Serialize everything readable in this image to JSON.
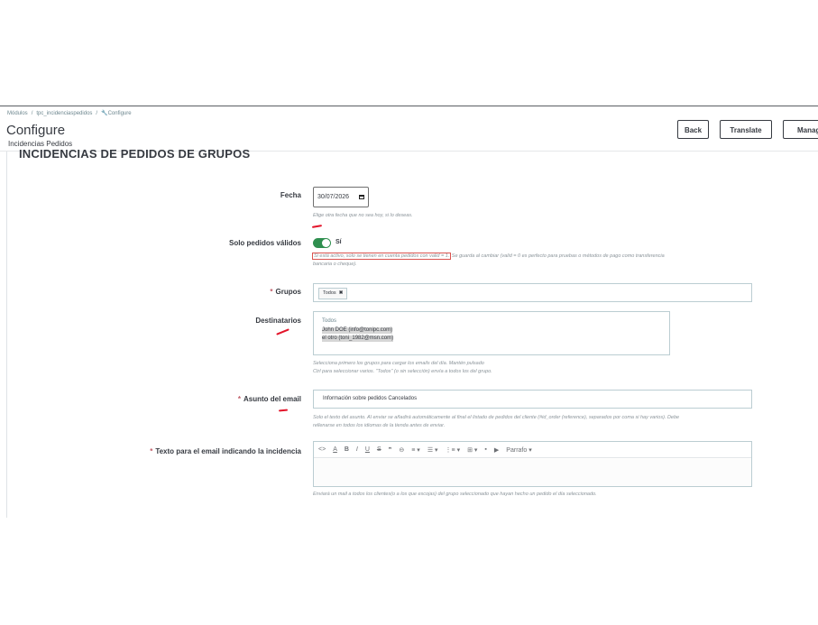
{
  "breadcrumb": [
    "Módulos",
    "tpc_incidenciaspedidos",
    "Configure"
  ],
  "header": {
    "title": "Configure",
    "subtitle": "Incidencias Pedidos",
    "buttons": {
      "back": "Back",
      "translate": "Translate",
      "manage": "Manage hoo"
    }
  },
  "section_title": "INCIDENCIAS DE PEDIDOS DE GRUPOS",
  "fields": {
    "fecha": {
      "label": "Fecha",
      "value": "30/07/2026",
      "help": "Elige otra fecha que no sea hoy, si lo deseas."
    },
    "solo_validos": {
      "label": "Solo pedidos válidos",
      "toggle_label": "Sí",
      "enabled": true,
      "help_boxed": "Si está activo, solo se tienen en cuenta pedidos con valid = 1.",
      "help_rest_1": " Se guarda al cambiar (valid = 0 es perfecto para pruebas o métodos de pago como transferencia",
      "help_rest_2": "bancaria o cheque)."
    },
    "grupos": {
      "label": "Grupos",
      "required": "*",
      "tag": "Todos",
      "tag_remove": "✖"
    },
    "destinatarios": {
      "label": "Destinatarios",
      "options": [
        "Todos",
        "John DOE (info@tonipc.com)",
        "el otro (toni_1982@msn.com)"
      ],
      "help_1": "Selecciona primero los grupos para cargar los emails del día. Mantén pulsado",
      "help_2": "Ctrl para seleccionar varios. \"Todos\" (o sin selección) envía a todos los del grupo."
    },
    "asunto": {
      "label": "Asunto del email",
      "required": "*",
      "value": "Información sobre pedidos Cancelados",
      "help_1": "Solo el texto del asunto. Al enviar se añadirá automáticamente al final el listado de pedidos del cliente (#id_order (reference), separados por coma si hay varios). Debe",
      "help_2": "rellenarse en todos los idiomas de la tienda antes de enviar."
    },
    "texto": {
      "label": "Texto para el email indicando la incidencia",
      "required": "*",
      "help": "Enviará un mail a todos los clientes(o a los que escojas) del grupo seleccionado que hayan hecho un pedido el día seleccionado."
    }
  },
  "editor_toolbar": {
    "code": "<>",
    "font_color": "A",
    "bold": "B",
    "italic": "I",
    "underline": "U",
    "strike": "S",
    "quote": "❞",
    "link": "⊖",
    "align": "≡ ▾",
    "bullets": "☰ ▾",
    "numbers": "⋮≡ ▾",
    "table": "⊞ ▾",
    "image": "▪",
    "video": "▶",
    "paragraph": "Parrafo ▾"
  },
  "colors": {
    "toggle_on": "#2f8f4f",
    "required": "#c05c67",
    "annotation_red": "#e3142a"
  }
}
